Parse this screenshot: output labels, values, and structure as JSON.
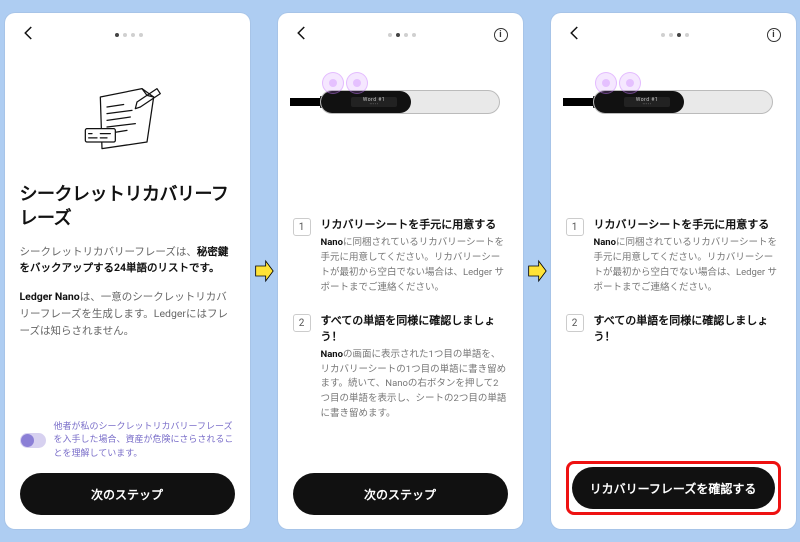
{
  "screen1": {
    "title": "シークレットリカバリーフレーズ",
    "para1_a": "シークレットリカバリーフレーズは、",
    "para1_b": "秘密鍵をバックアップする24単語のリストです。",
    "para2_a": "Ledger Nano",
    "para2_b": "は、一意のシークレットリカバリーフレーズを生成します。Ledgerにはフレーズは知らされません。",
    "warn": "他者が私のシークレットリカバリーフレーズを入手した場合、資産が危険にさらされることを理解しています。",
    "cta": "次のステップ"
  },
  "screen2": {
    "step1_title": "リカバリーシートを手元に用意する",
    "step1_text_a": "Nano",
    "step1_text_b": "に同梱されているリカバリーシートを手元に用意してください。リカバリーシートが最初から空白でない場合は、Ledger サポートまでご連絡ください。",
    "step2_title": "すべての単語を同様に確認しましょう！",
    "step2_text_a": "Nano",
    "step2_text_b": "の画面に表示された1つ目の単語を、リカバリーシートの1つ目の単語に書き留めます。続いて、Nanoの右ボタンを押して2つ目の単語を表示し、シートの2つ目の単語に書き留めます。",
    "cta": "次のステップ"
  },
  "screen3": {
    "step1_title": "リカバリーシートを手元に用意する",
    "step1_text_a": "Nano",
    "step1_text_b": "に同梱されているリカバリーシートを手元に用意してください。リカバリーシートが最初から空白でない場合は、Ledger サポートまでご連絡ください。",
    "step2_title": "すべての単語を同様に確認しましょう！",
    "cta": "リカバリーフレーズを確認する"
  }
}
